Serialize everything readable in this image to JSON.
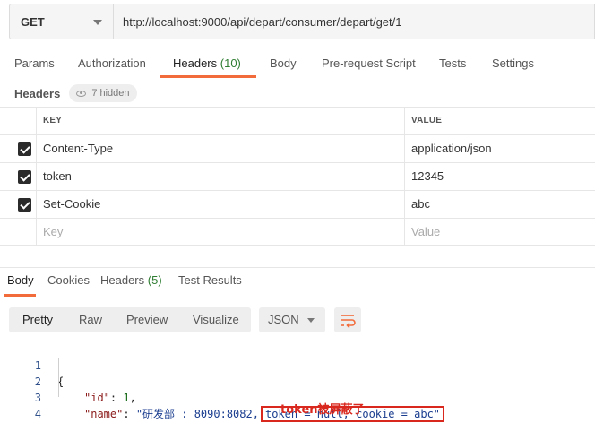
{
  "request": {
    "method": "GET",
    "url": "http://localhost:9000/api/depart/consumer/depart/get/1"
  },
  "request_tabs": [
    {
      "label": "Params",
      "count": ""
    },
    {
      "label": "Authorization",
      "count": ""
    },
    {
      "label": "Headers",
      "count": "(10)"
    },
    {
      "label": "Body",
      "count": ""
    },
    {
      "label": "Pre-request Script",
      "count": ""
    },
    {
      "label": "Tests",
      "count": ""
    },
    {
      "label": "Settings",
      "count": ""
    }
  ],
  "active_request_tab": "Headers",
  "headers_section": {
    "title": "Headers",
    "hidden_label": "7 hidden"
  },
  "headers_table": {
    "columns": [
      "KEY",
      "VALUE"
    ],
    "rows": [
      {
        "checked": true,
        "key": "Content-Type",
        "value": "application/json"
      },
      {
        "checked": true,
        "key": "token",
        "value": "12345"
      },
      {
        "checked": true,
        "key": "Set-Cookie",
        "value": "abc"
      }
    ],
    "key_placeholder": "Key",
    "value_placeholder": "Value"
  },
  "response_tabs": [
    {
      "label": "Body",
      "count": ""
    },
    {
      "label": "Cookies",
      "count": ""
    },
    {
      "label": "Headers",
      "count": "(5)"
    },
    {
      "label": "Test Results",
      "count": ""
    }
  ],
  "active_response_tab": "Body",
  "view_modes": [
    "Pretty",
    "Raw",
    "Preview",
    "Visualize"
  ],
  "active_view_mode": "Pretty",
  "format": "JSON",
  "response_body": {
    "line_numbers": [
      "1",
      "2",
      "3",
      "4"
    ],
    "open_brace": "{",
    "close_brace": "}",
    "id_key": "\"id\"",
    "id_value": "1",
    "name_key": "\"name\"",
    "name_value_prefix": "\"研发部 : 8090:8082,",
    "name_value_highlight": "token = null, cookie = abc\""
  },
  "annotation": "token被屏蔽了",
  "colors": {
    "accent": "#f26b3a",
    "highlight_box": "#d9281e",
    "count_green": "#2e7d32"
  }
}
